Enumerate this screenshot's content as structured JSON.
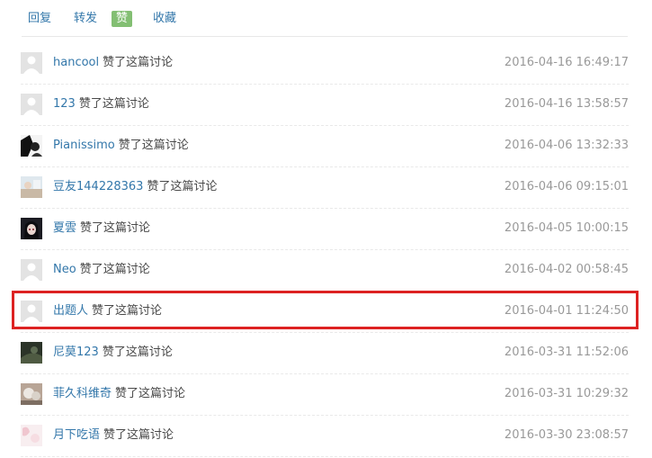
{
  "tabs": [
    {
      "label": "回复",
      "active": false
    },
    {
      "label": "转发",
      "active": false
    },
    {
      "label": "赞",
      "active": true
    },
    {
      "label": "收藏",
      "active": false
    }
  ],
  "colors": {
    "link": "#3377aa",
    "active_tab": "#83bf73",
    "timestamp": "#999999",
    "highlight": "#dd2222"
  },
  "likes": [
    {
      "user": "hancool",
      "action": "赞了这篇讨论",
      "time": "2016-04-16 16:49:17",
      "avatar": "default-avatar"
    },
    {
      "user": "123",
      "action": "赞了这篇讨论",
      "time": "2016-04-16 13:58:57",
      "avatar": "default-avatar"
    },
    {
      "user": "Pianissimo",
      "action": "赞了这篇讨论",
      "time": "2016-04-06 13:32:33",
      "avatar": "bw-portrait-avatar"
    },
    {
      "user": "豆友144228363",
      "action": "赞了这篇讨论",
      "time": "2016-04-06 09:15:01",
      "avatar": "light-photo-avatar"
    },
    {
      "user": "夏雲",
      "action": "赞了这篇讨论",
      "time": "2016-04-05 10:00:15",
      "avatar": "anime-girl-avatar"
    },
    {
      "user": "Neo",
      "action": "赞了这篇讨论",
      "time": "2016-04-02 00:58:45",
      "avatar": "default-avatar"
    },
    {
      "user": "出题人",
      "action": "赞了这篇讨论",
      "time": "2016-04-01 11:24:50",
      "avatar": "default-avatar",
      "highlighted": true
    },
    {
      "user": "尼莫123",
      "action": "赞了这篇讨论",
      "time": "2016-03-31 11:52:06",
      "avatar": "dark-photo-avatar"
    },
    {
      "user": "菲久科维奇",
      "action": "赞了这篇讨论",
      "time": "2016-03-31 10:29:32",
      "avatar": "pet-photo-avatar"
    },
    {
      "user": "月下吃语",
      "action": "赞了这篇讨论",
      "time": "2016-03-30 23:08:57",
      "avatar": "pink-photo-avatar"
    }
  ]
}
